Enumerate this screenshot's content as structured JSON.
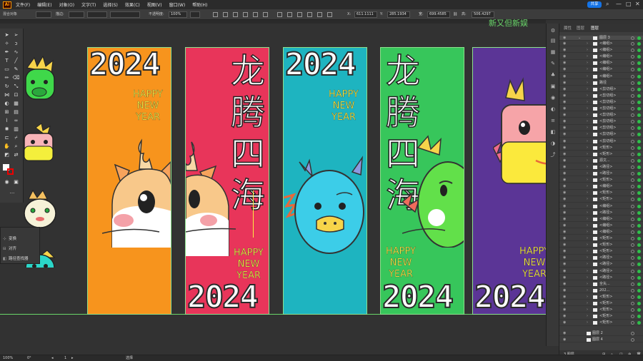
{
  "menubar": {
    "logo": "Ai",
    "items": [
      "文件(F)",
      "编辑(E)",
      "对象(O)",
      "文字(T)",
      "选择(S)",
      "效果(C)",
      "视图(V)",
      "窗口(W)",
      "帮助(H)"
    ],
    "share_label": "共享"
  },
  "control_bar": {
    "selection_label": "混合对象",
    "stroke_label": "描边:",
    "opacity_label": "不透明度:",
    "opacity_value": "100%",
    "x_label": "X:",
    "x_value": "611.1111",
    "y_label": "Y:",
    "y_value": "285.1934",
    "w_label": "宽:",
    "w_value": "699.4585",
    "h_label": "高:",
    "h_value": "506.4297"
  },
  "transform_panel": {
    "items": [
      "变换",
      "对齐",
      "路径查找器"
    ]
  },
  "banners": {
    "year": "2024",
    "happy": "HAPPY",
    "new": "NEW",
    "year_word": "YEAR",
    "cjk_lines": [
      "龙",
      "腾",
      "四",
      "海"
    ],
    "partial_text": "新又但新娱"
  },
  "layers_panel": {
    "tabs": [
      "属性",
      "图层",
      "图层"
    ],
    "top_layer": "图层 3",
    "rows": [
      "<编组>",
      "<编组>",
      "<编组>",
      "<编组>",
      "<编组>",
      "<编组>",
      "路径",
      "<剪切组>",
      "<剪切组>",
      "<剪切组>",
      "<剪切组>",
      "<剪切组>",
      "<剪切组>",
      "<剪切组>",
      "<剪切组>",
      "<剪切组>",
      "<矩形>",
      "<矩形>",
      "源文...",
      "<路径>",
      "<路径>",
      "<矩形>",
      "<编组>",
      "<矩形>",
      "<矩形>",
      "<编组>",
      "<路径>",
      "<编组>",
      "<编组>",
      "<编组>",
      "<矩形>",
      "<矩形>",
      "<矩形>",
      "<路径>",
      "<路径>",
      "<路径>",
      "<路径>",
      "全矢...",
      "202...",
      "<矩形>",
      "<矩形>",
      "<矩形>",
      "<矩形>",
      "<矩形>"
    ],
    "bottom_layers": [
      "图层 2",
      "图层 4"
    ],
    "footer_label": "3 图层"
  },
  "statusbar": {
    "zoom": "100%",
    "angle": "0°",
    "artboard": "1",
    "tool": "选择"
  },
  "colors": {
    "orange": "#f7941d",
    "red": "#e8355a",
    "teal": "#1eb4c0",
    "green": "#37c65b",
    "purple": "#5b3596",
    "accent": "#1473e6"
  }
}
